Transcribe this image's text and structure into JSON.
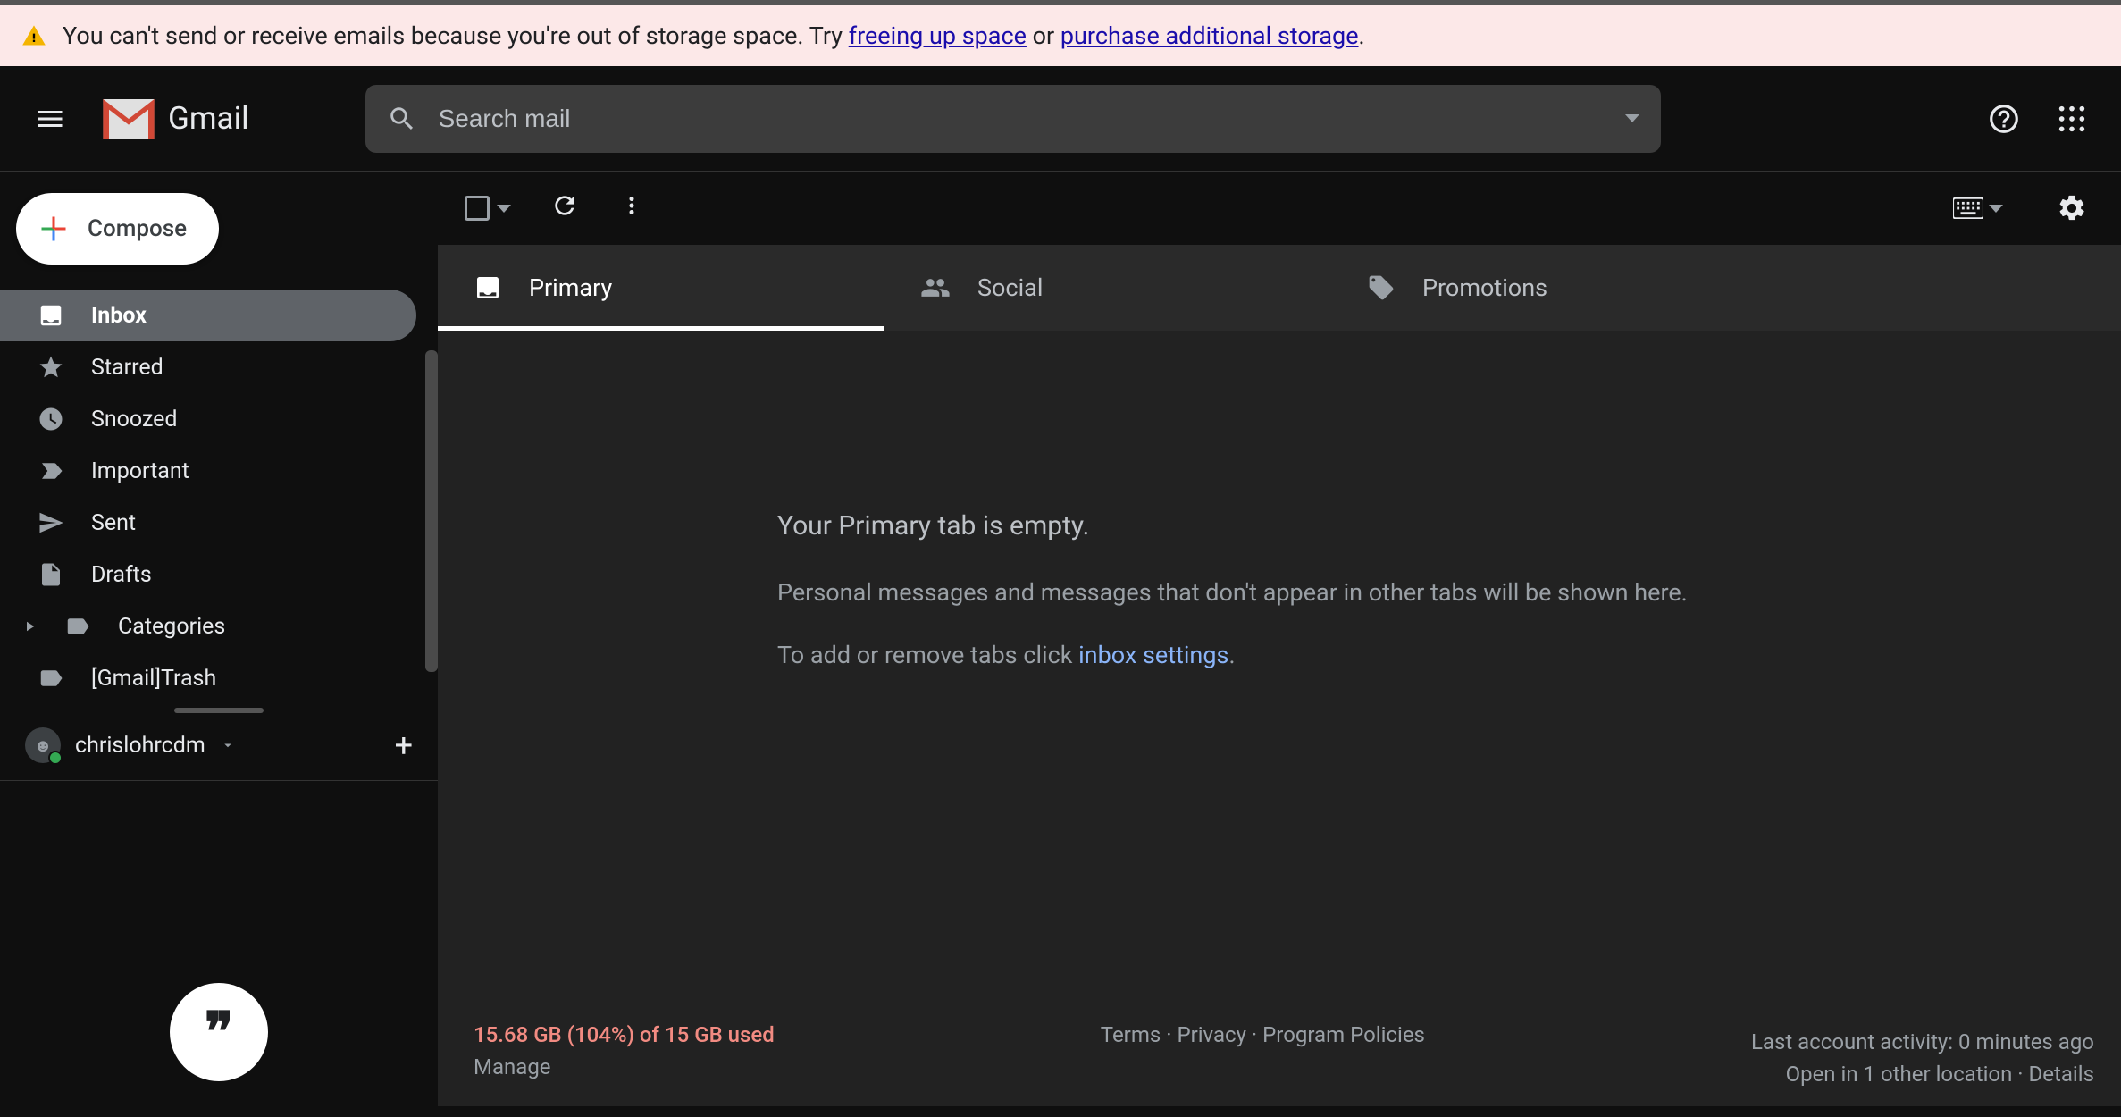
{
  "banner": {
    "text_pre": "You can't send or receive emails because you're out of storage space. Try ",
    "link1": "freeing up space",
    "text_mid": " or ",
    "link2": "purchase additional storage",
    "text_post": "."
  },
  "header": {
    "app_name": "Gmail",
    "search_placeholder": "Search mail"
  },
  "compose_label": "Compose",
  "sidebar": {
    "items": [
      {
        "label": "Inbox"
      },
      {
        "label": "Starred"
      },
      {
        "label": "Snoozed"
      },
      {
        "label": "Important"
      },
      {
        "label": "Sent"
      },
      {
        "label": "Drafts"
      },
      {
        "label": "Categories"
      },
      {
        "label": "[Gmail]Trash"
      }
    ]
  },
  "hangouts": {
    "name": "chrislohrcdm",
    "bubble": "❞"
  },
  "tabs": {
    "primary": "Primary",
    "social": "Social",
    "promotions": "Promotions"
  },
  "empty": {
    "title": "Your Primary tab is empty.",
    "line2": "Personal messages and messages that don't appear in other tabs will be shown here.",
    "line3_pre": "To add or remove tabs click ",
    "line3_link": "inbox settings",
    "line3_post": "."
  },
  "footer": {
    "usage": "15.68 GB (104%) of 15 GB used",
    "manage": "Manage",
    "terms": "Terms",
    "privacy": "Privacy",
    "policies": "Program Policies",
    "activity": "Last account activity: 0 minutes ago",
    "open_in": "Open in 1 other location",
    "details": "Details",
    "dot": " · "
  }
}
